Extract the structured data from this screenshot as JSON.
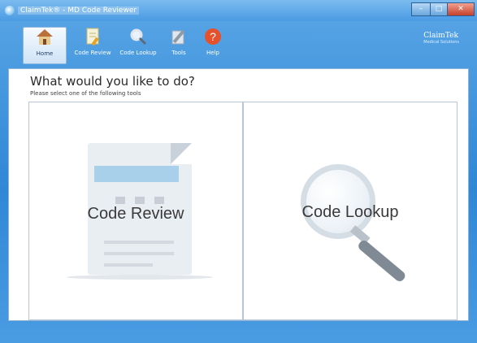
{
  "window": {
    "title": "ClaimTek® - MD Code Reviewer"
  },
  "toolbar": {
    "items": [
      {
        "label": "Home",
        "icon": "home-icon",
        "active": true
      },
      {
        "label": "Code Review",
        "icon": "document-edit-icon",
        "active": false
      },
      {
        "label": "Code Lookup",
        "icon": "magnifier-icon",
        "active": false
      },
      {
        "label": "Tools",
        "icon": "tools-icon",
        "active": false
      },
      {
        "label": "Help",
        "icon": "help-icon",
        "active": false
      }
    ],
    "logo_text": "ClaimTek",
    "logo_tagline": "Medical Solutions"
  },
  "main": {
    "heading": "What would you like to do?",
    "subheading": "Please select one of the following tools",
    "options": [
      {
        "label": "Code Review",
        "illustration": "document-icon"
      },
      {
        "label": "Code Lookup",
        "illustration": "magnifier-icon"
      }
    ]
  },
  "colors": {
    "frame": "#2f87d6",
    "titlebar": "#4a9be3",
    "content_bg": "#ffffff",
    "close_button": "#c6402b",
    "help_icon": "#e5512d",
    "doc_band": "#a9d0ea"
  }
}
